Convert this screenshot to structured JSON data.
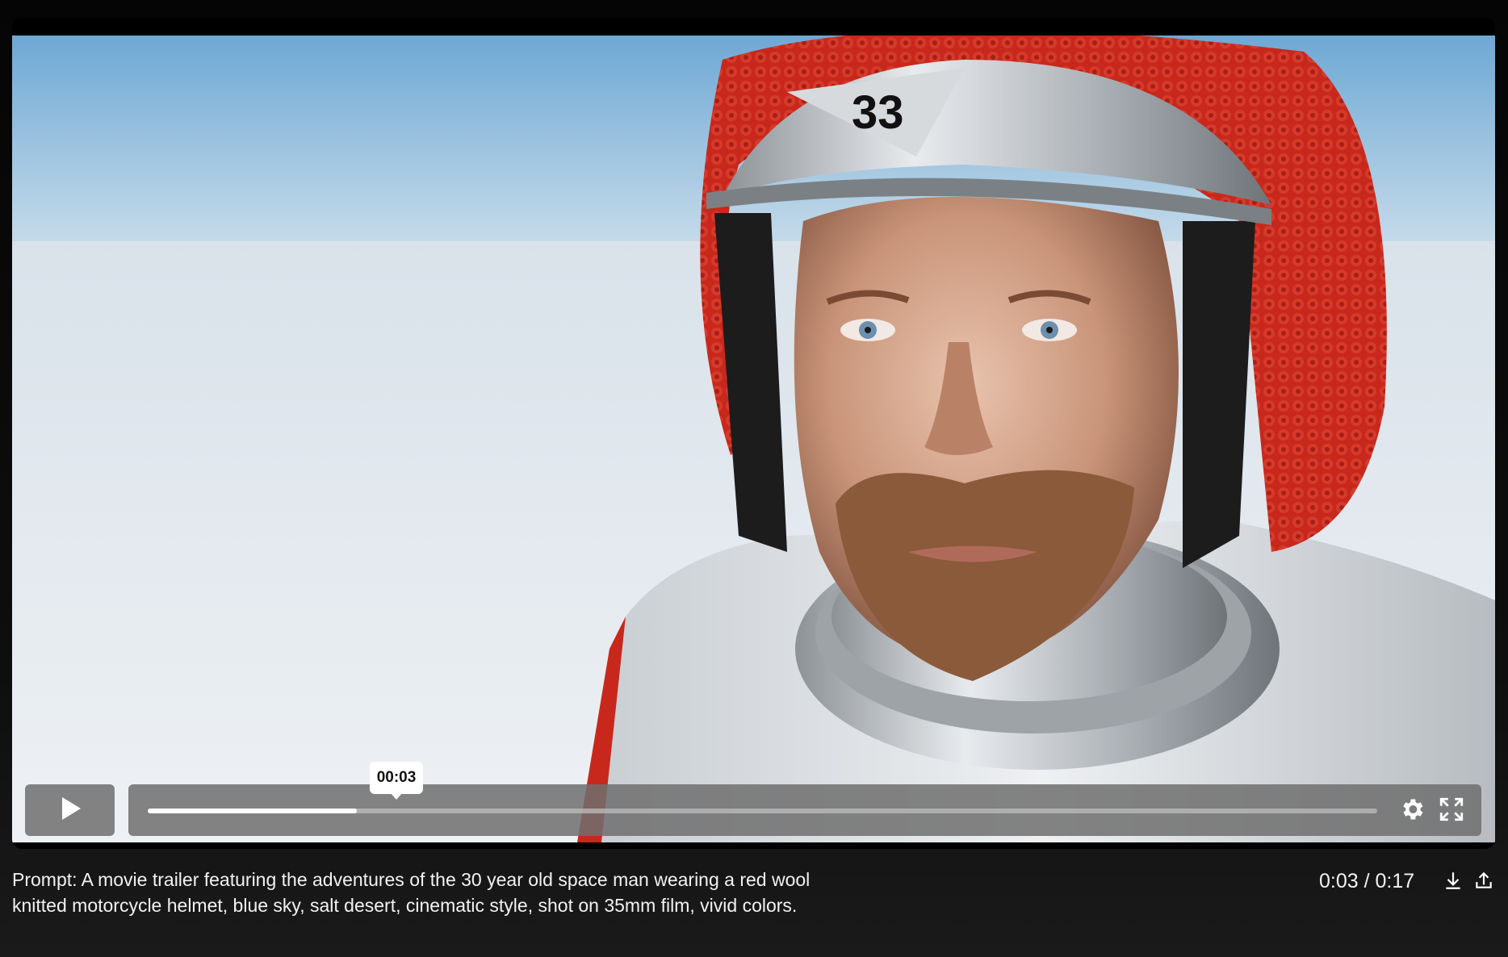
{
  "video": {
    "helmet_number": "33",
    "current_time_tooltip": "00:03",
    "progress": 0.17,
    "colors": {
      "sky_top": "#6ea8d4",
      "salt_flat": "#e7ebef",
      "helmet_wool": "#c8281c",
      "helmet_metal": "#bfc3c7"
    }
  },
  "controls": {
    "play_icon": "play-icon",
    "settings_icon": "gear-icon",
    "fullscreen_icon": "fullscreen-icon"
  },
  "caption": {
    "text": "Prompt: A movie trailer featuring the adventures of the 30 year old space man wearing a red wool knitted motorcycle helmet, blue sky, salt desert, cinematic style, shot on 35mm film, vivid colors."
  },
  "time": {
    "display": "0:03 / 0:17"
  },
  "actions": {
    "download_icon": "download-icon",
    "share_icon": "share-icon"
  }
}
